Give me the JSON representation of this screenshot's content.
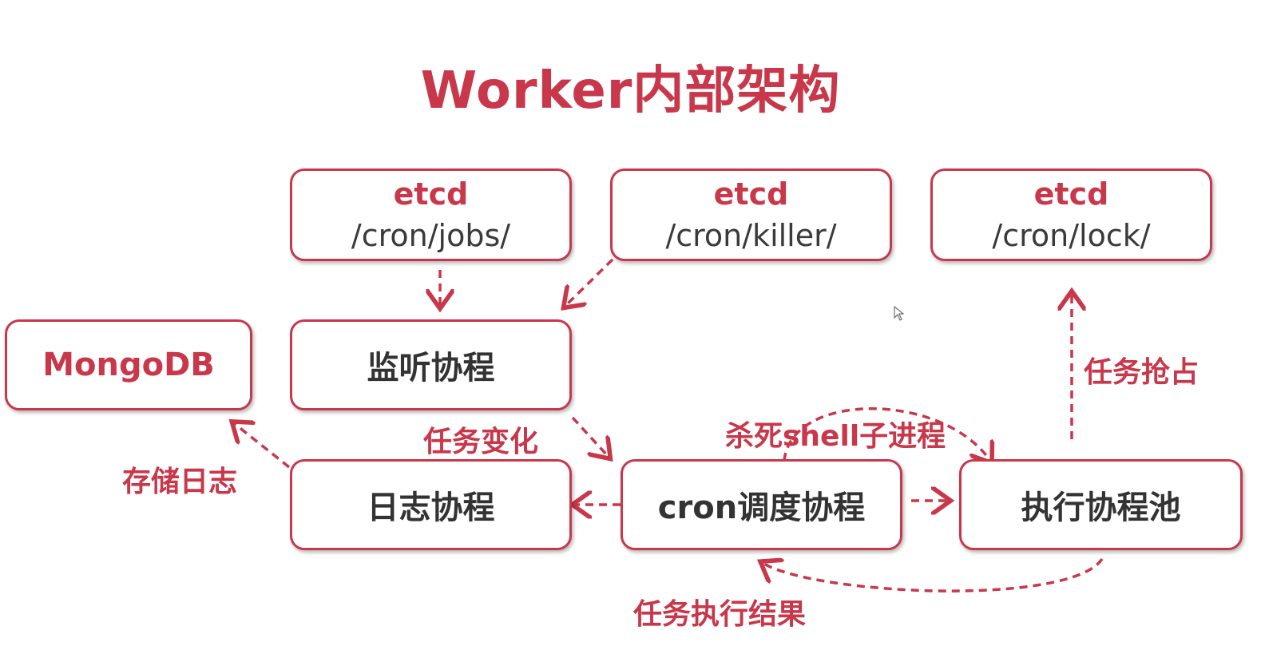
{
  "title": "Worker内部架构",
  "boxes": {
    "etcd_jobs": {
      "line1": "etcd",
      "line2": "/cron/jobs/"
    },
    "etcd_killer": {
      "line1": "etcd",
      "line2": "/cron/killer/"
    },
    "etcd_lock": {
      "line1": "etcd",
      "line2": "/cron/lock/"
    },
    "mongodb": "MongoDB",
    "watcher": "监听协程",
    "logger": "日志协程",
    "scheduler": "cron调度协程",
    "executor": "执行协程池"
  },
  "edge_labels": {
    "job_change": "任务变化",
    "store_log": "存储日志",
    "kill_shell": "杀死shell子进程",
    "grab_task": "任务抢占",
    "task_result": "任务执行结果"
  },
  "colors": {
    "accent": "#c8374a",
    "text_dark": "#333333"
  },
  "icons": [
    "mouse-cursor-icon"
  ]
}
